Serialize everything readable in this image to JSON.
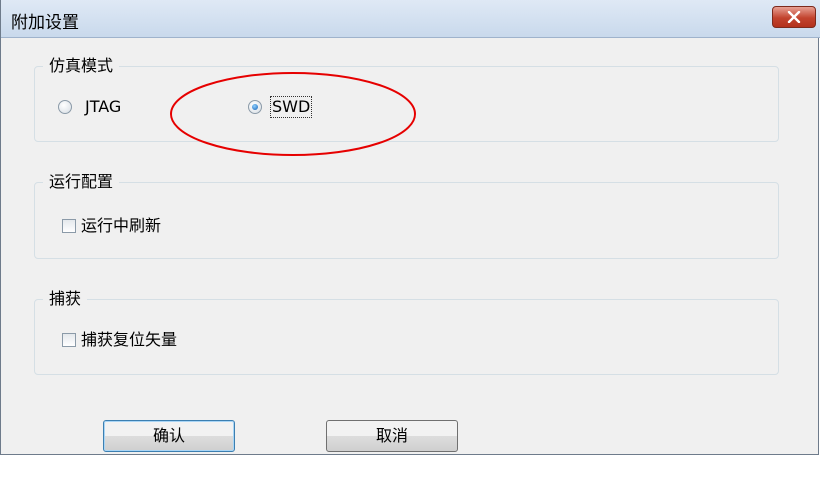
{
  "window": {
    "title": "附加设置"
  },
  "titlebar": {
    "close_icon": "close-icon"
  },
  "groups": {
    "sim_mode": {
      "legend": "仿真模式",
      "options": [
        {
          "label": "JTAG",
          "checked": false
        },
        {
          "label": "SWD",
          "checked": true
        }
      ]
    },
    "run_config": {
      "legend": "运行配置",
      "checkbox": {
        "label": "运行中刷新",
        "checked": false
      }
    },
    "capture": {
      "legend": "捕获",
      "checkbox": {
        "label": "捕获复位矢量",
        "checked": false
      }
    }
  },
  "buttons": {
    "ok": "确认",
    "cancel": "取消"
  },
  "annotation": {
    "color": "#e60000",
    "shape": "ellipse"
  }
}
